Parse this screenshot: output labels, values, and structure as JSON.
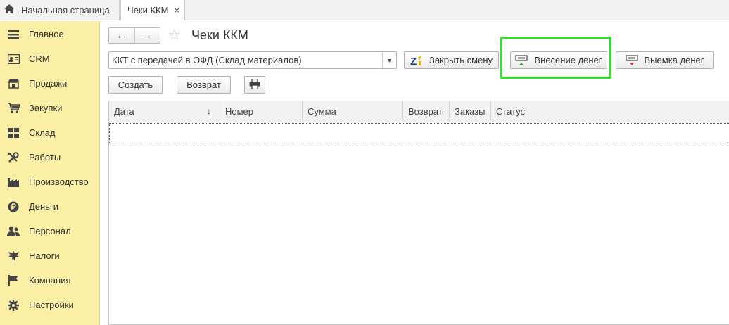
{
  "tabs": {
    "home_label": "Начальная страница",
    "active_label": "Чеки ККМ",
    "close_glyph": "×"
  },
  "sidebar": {
    "items": [
      {
        "label": "Главное",
        "icon": "menu-icon"
      },
      {
        "label": "CRM",
        "icon": "crm-icon"
      },
      {
        "label": "Продажи",
        "icon": "shop-icon"
      },
      {
        "label": "Закупки",
        "icon": "cart-icon"
      },
      {
        "label": "Склад",
        "icon": "warehouse-icon"
      },
      {
        "label": "Работы",
        "icon": "tools-icon"
      },
      {
        "label": "Производство",
        "icon": "factory-icon"
      },
      {
        "label": "Деньги",
        "icon": "ruble-icon"
      },
      {
        "label": "Персонал",
        "icon": "people-icon"
      },
      {
        "label": "Налоги",
        "icon": "eagle-icon"
      },
      {
        "label": "Компания",
        "icon": "flag-icon"
      },
      {
        "label": "Настройки",
        "icon": "gear-icon"
      }
    ]
  },
  "header": {
    "title": "Чеки ККМ",
    "back_glyph": "←",
    "forward_glyph": "→",
    "star_glyph": "☆"
  },
  "toolbar": {
    "kkt_value": "ККТ с передачей в ОФД (Склад материалов)",
    "close_shift_label": "Закрыть смену",
    "cash_in_label": "Внесение денег",
    "cash_out_label": "Выемка денег",
    "create_label": "Создать",
    "return_label": "Возврат"
  },
  "table": {
    "columns": [
      "Дата",
      "Номер",
      "Сумма",
      "Возврат",
      "Заказы",
      "Статус"
    ],
    "sort_glyph": "↓"
  },
  "colors": {
    "sidebar_bg": "#fbeea5",
    "highlight": "#2fe02f"
  }
}
